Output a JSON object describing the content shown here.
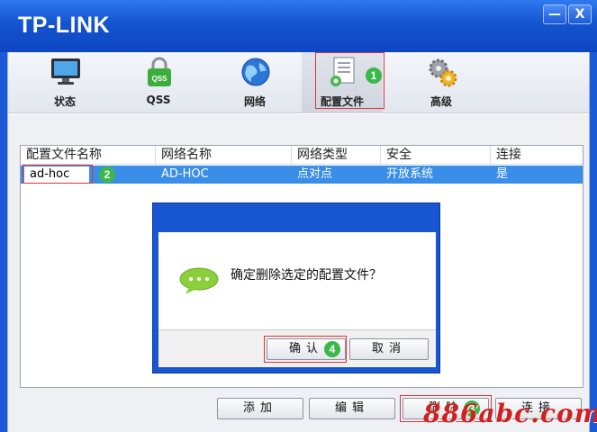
{
  "window": {
    "logo": "TP-LINK",
    "minimize": "—",
    "close": "X"
  },
  "nav": {
    "items": [
      {
        "label": "状态",
        "icon": "monitor-icon"
      },
      {
        "label": "QSS",
        "icon": "qss-lock-icon",
        "icon_text": "QSS"
      },
      {
        "label": "网络",
        "icon": "globe-icon"
      },
      {
        "label": "配置文件",
        "icon": "profile-document-icon",
        "active": true
      },
      {
        "label": "高级",
        "icon": "gears-icon"
      }
    ]
  },
  "annotations": {
    "step1": "1",
    "step2": "2",
    "step3": "3",
    "step4": "4"
  },
  "table": {
    "columns": [
      "配置文件名称",
      "网络名称",
      "网络类型",
      "安全",
      "连接"
    ],
    "rows": [
      {
        "profile": "ad-hoc",
        "network": "AD-HOC",
        "type": "点对点",
        "security": "开放系统",
        "connected": "是"
      }
    ]
  },
  "dialog": {
    "message": "确定删除选定的配置文件？",
    "confirm_label": "确认",
    "cancel_label": "取消"
  },
  "buttons": {
    "add": "添加",
    "edit": "编辑",
    "delete": "删除",
    "connect": "连接"
  },
  "watermark": "886abc.com",
  "colors": {
    "titlebar": "#1553cf",
    "selection": "#3a8ee8",
    "highlight": "#e0343c",
    "badge": "#3bb84a"
  }
}
